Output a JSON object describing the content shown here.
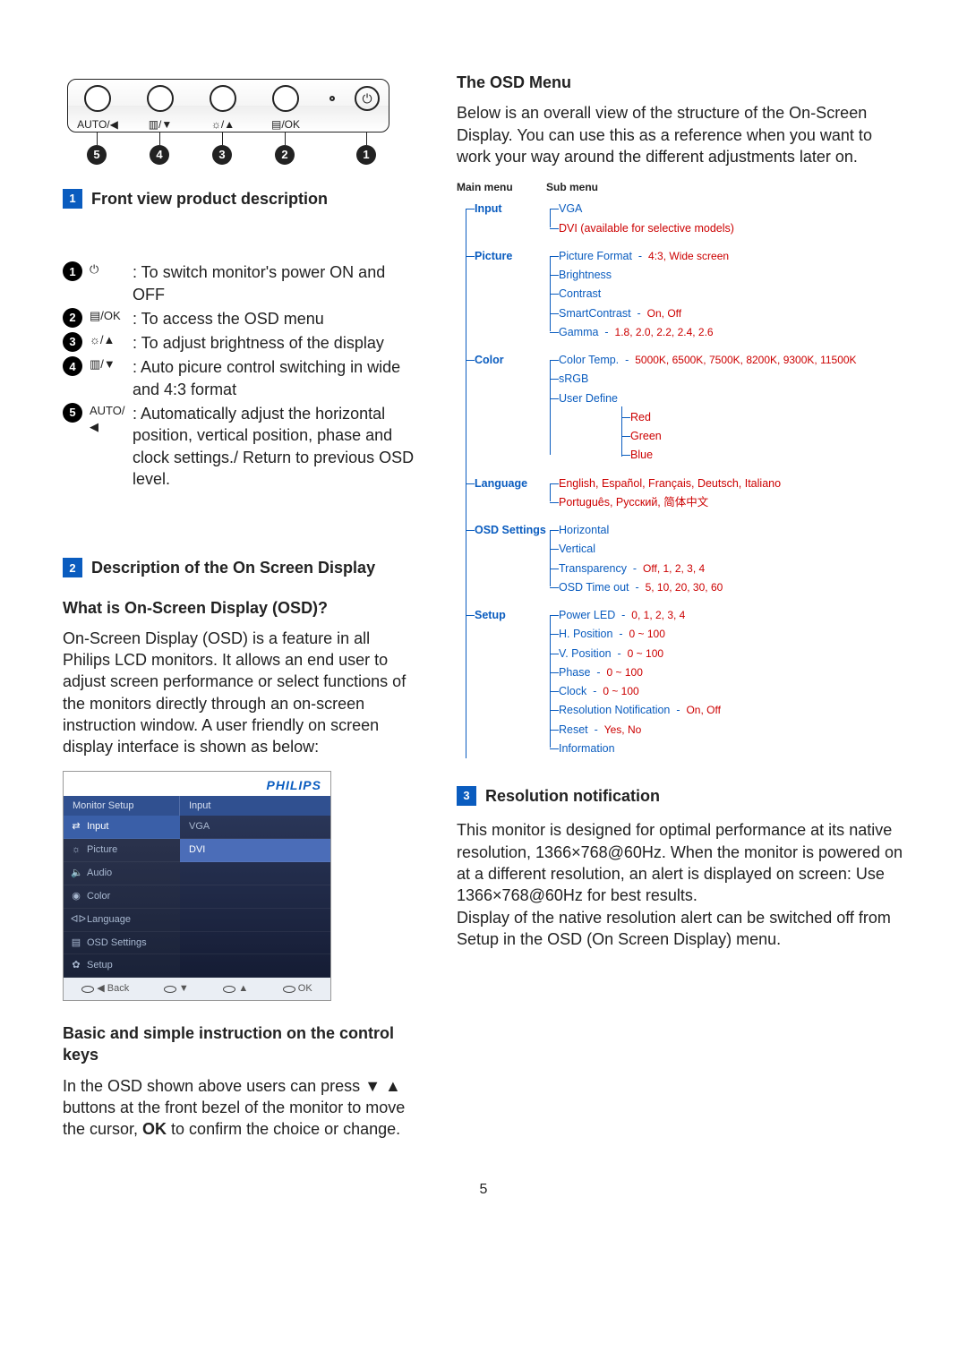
{
  "diagram_labels": [
    "AUTO/◀",
    "▥/▼",
    "☼/▲",
    "▤/OK"
  ],
  "diagram_pointers": [
    "5",
    "4",
    "3",
    "2",
    "1"
  ],
  "sections": {
    "s1_title": "Front view product description",
    "s2_title": "Description of the On Screen Display",
    "s3_title": "Resolution notification"
  },
  "desc_list": [
    {
      "glyph": "⏻",
      "text": ": To switch monitor's power ON and OFF"
    },
    {
      "glyph": "▤/OK",
      "text": ": To access the OSD menu"
    },
    {
      "glyph": "☼/▲",
      "text": ": To adjust brightness of the display"
    },
    {
      "glyph": "▥/▼",
      "text": ": Auto picure control switching in wide and 4:3 format"
    },
    {
      "glyph": "AUTO/◀",
      "text": ": Automatically adjust the horizontal position, vertical position, phase and clock settings./ Return to previous OSD level."
    }
  ],
  "osd_question": "What is On-Screen Display (OSD)?",
  "osd_para": "On-Screen Display (OSD) is a feature in all Philips LCD monitors. It allows an end user to adjust screen performance or select functions of the monitors directly through an on-screen instruction window. A user friendly on screen display interface is shown as below:",
  "osd_shot": {
    "brand": "PHILIPS",
    "header_left": "Monitor Setup",
    "header_right": "Input",
    "menu": [
      {
        "icon": "⇄",
        "label": "Input",
        "selected": true
      },
      {
        "icon": "☼",
        "label": "Picture"
      },
      {
        "icon": "🔈",
        "label": "Audio"
      },
      {
        "icon": "◉",
        "label": "Color"
      },
      {
        "icon": "ᐊᐅ",
        "label": "Language"
      },
      {
        "icon": "▤",
        "label": "OSD Settings"
      },
      {
        "icon": "✿",
        "label": "Setup"
      }
    ],
    "sub": [
      "VGA",
      "DVI"
    ],
    "footer": [
      "◀ Back",
      "▼",
      "▲",
      "OK"
    ]
  },
  "basic_heading": "Basic and simple instruction on the control keys",
  "basic_para_pre": "In the OSD shown above users can press ",
  "basic_para_glyph": "▼ ▲",
  "basic_para_mid": " buttons at the front bezel of the monitor to move the cursor, ",
  "basic_para_ok": "OK",
  "basic_para_post": " to confirm the choice or change.",
  "right": {
    "heading": "The OSD Menu",
    "intro": "Below is an overall view of the structure of the On-Screen Display. You can use this as a reference when you want to work your way around the different adjustments later on.",
    "tree_hdr_main": "Main menu",
    "tree_hdr_sub": "Sub menu",
    "chart_data": {
      "type": "tree",
      "nodes": [
        {
          "main": "Input",
          "sub": [
            {
              "label": "VGA"
            },
            {
              "label": "DVI (available for selective models)",
              "red": true
            }
          ]
        },
        {
          "main": "Picture",
          "sub": [
            {
              "label": "Picture Format",
              "vals": "4:3, Wide screen"
            },
            {
              "label": "Brightness"
            },
            {
              "label": "Contrast"
            },
            {
              "label": "SmartContrast",
              "vals": "On, Off"
            },
            {
              "label": "Gamma",
              "vals": "1.8, 2.0, 2.2, 2.4, 2.6"
            }
          ]
        },
        {
          "main": "Color",
          "sub": [
            {
              "label": "Color Temp.",
              "vals": "5000K, 6500K, 7500K, 8200K, 9300K, 11500K"
            },
            {
              "label": "sRGB"
            },
            {
              "label": "User Define",
              "children": [
                {
                  "label": "Red",
                  "red": true
                },
                {
                  "label": "Green",
                  "red": true
                },
                {
                  "label": "Blue",
                  "red": true
                }
              ]
            }
          ]
        },
        {
          "main": "Language",
          "sub": [
            {
              "label": "English, Español, Français, Deutsch, Italiano",
              "red": true
            },
            {
              "label": "Português, Русский, 简体中文",
              "red": true
            }
          ]
        },
        {
          "main": "OSD Settings",
          "sub": [
            {
              "label": "Horizontal"
            },
            {
              "label": "Vertical"
            },
            {
              "label": "Transparency",
              "vals": "Off, 1, 2, 3, 4"
            },
            {
              "label": "OSD Time out",
              "vals": "5, 10, 20, 30, 60"
            }
          ]
        },
        {
          "main": "Setup",
          "sub": [
            {
              "label": "Power LED",
              "vals": "0, 1, 2, 3, 4"
            },
            {
              "label": "H. Position",
              "vals": "0 ~ 100"
            },
            {
              "label": "V. Position",
              "vals": "0 ~ 100"
            },
            {
              "label": "Phase",
              "vals": "0 ~ 100"
            },
            {
              "label": "Clock",
              "vals": "0 ~ 100"
            },
            {
              "label": "Resolution Notification",
              "vals": "On, Off"
            },
            {
              "label": "Reset",
              "vals": "Yes, No"
            },
            {
              "label": "Information"
            }
          ]
        }
      ]
    },
    "res_para": "This monitor is designed for optimal performance at its native resolution, 1366×768@60Hz. When the monitor is powered on at a different resolution, an alert is displayed on screen: Use 1366×768@60Hz for best results.\nDisplay of the native resolution alert can be switched off from Setup in the OSD (On Screen Display) menu."
  },
  "page_number": "5"
}
